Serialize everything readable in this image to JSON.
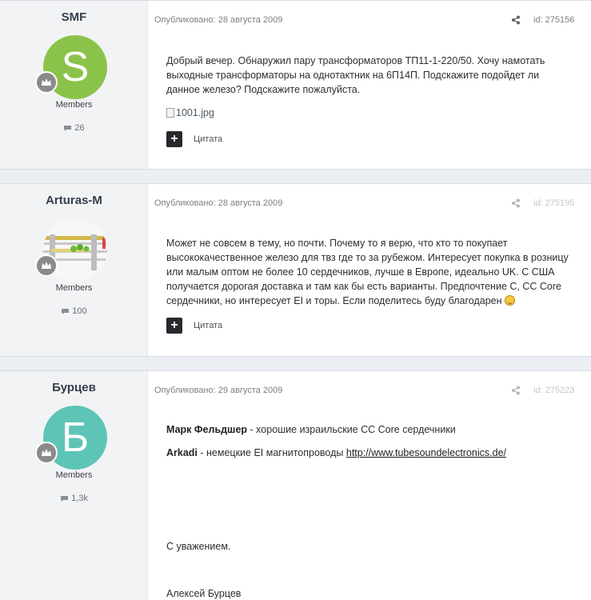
{
  "posts": [
    {
      "author": "SMF",
      "avatar_letter": "S",
      "avatar_color": "#8bc34a",
      "group": "Members",
      "post_count": "26",
      "published": "Опубликовано: 28 августа 2009",
      "post_id": "id: 275156",
      "paragraphs": [
        "Добрый вечер. Обнаружил пару трансформаторов ТП11-1-220/50. Хочу намотать выходные трансформаторы на однотактник на 6П14П. Подскажите подойдет ли данное железо? Подскажите пожалуйста."
      ],
      "image_alt": "1001.jpg",
      "quote_label": "Цитата"
    },
    {
      "author": "Arturas-M",
      "group": "Members",
      "post_count": "100",
      "published": "Опубликовано: 28 августа 2009",
      "post_id": "id: 275195",
      "paragraphs": [
        "Может не совсем в тему, но почти. Почему то я верю, что кто то покупает высококачественное железо для твз где то за рубежом. Интересует покупка в розницу или малым оптом не более 10 сердечников, лучше в Европе, идеально UK. С США получается дорогая доставка и там как бы есть варианты. Предпочтение C, CC Core сердечники, но интересует EI и торы. Если поделитесь буду благодарен"
      ],
      "quote_label": "Цитата"
    },
    {
      "author": "Бурцев",
      "avatar_letter": "Б",
      "avatar_color": "#5ec4b6",
      "group": "Members",
      "post_count": "1,3k",
      "published": "Опубликовано: 29 августа 2009",
      "post_id": "id: 275223",
      "line1_bold": "Марк Фельдшер",
      "line1_rest": " - хорошие израильские CC Core сердечники",
      "line2_bold": "Arkadi",
      "line2_rest": " - немецкие EI магнитопроводы ",
      "line2_link": "http://www.tubesoundelectronics.de/",
      "regards": "С уважением.",
      "signature": "Алексей Бурцев"
    }
  ],
  "icons": {
    "share": "share-icon",
    "comment": "comment-bubble-icon",
    "rank": "rank-badge-icon",
    "quote_plus": "plus-icon",
    "smiley": "smiley-icon"
  }
}
